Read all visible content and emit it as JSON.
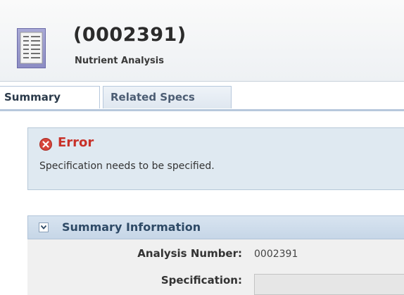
{
  "header": {
    "title": "(0002391)",
    "subtitle": "Nutrient Analysis",
    "icon": "document-list-icon"
  },
  "tabs": [
    {
      "label": "Summary",
      "active": true
    },
    {
      "label": "Related Specs",
      "active": false
    }
  ],
  "error": {
    "title": "Error",
    "message": "Specification needs to be specified.",
    "icon": "error-circle-x-icon",
    "color": "#c8322a"
  },
  "summary_section": {
    "title": "Summary Information",
    "toggle_icon": "chevron-down-icon",
    "fields": [
      {
        "label": "Analysis Number:",
        "value": "0002391"
      },
      {
        "label": "Specification:",
        "value": ""
      }
    ]
  }
}
